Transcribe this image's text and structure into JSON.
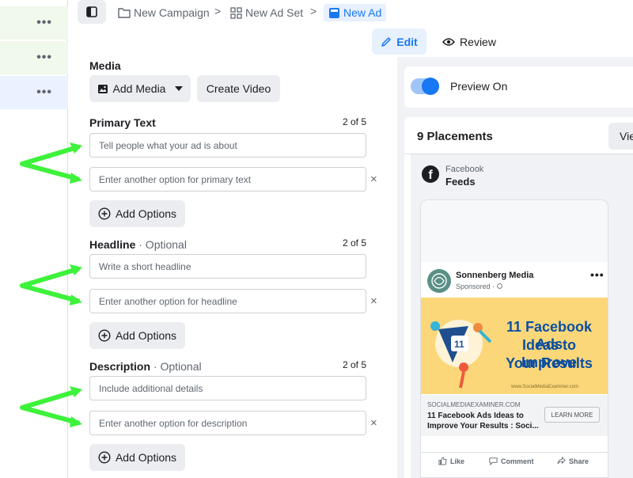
{
  "sidebar": {
    "rows": [
      "•••",
      "•••",
      "•••"
    ]
  },
  "breadcrumb": {
    "campaign": "New Campaign",
    "adset": "New Ad Set",
    "ad": "New Ad",
    "sep": ">"
  },
  "mode": {
    "edit": "Edit",
    "review": "Review"
  },
  "media": {
    "title": "Media",
    "add_media": "Add Media",
    "create_video": "Create Video"
  },
  "primary_text": {
    "title": "Primary Text",
    "count": "2 of 5",
    "field1_placeholder": "Tell people what your ad is about",
    "field2_placeholder": "Enter another option for primary text",
    "add_options": "Add Options"
  },
  "headline": {
    "title": "Headline",
    "optional": "· Optional",
    "count": "2 of 5",
    "field1_placeholder": "Write a short headline",
    "field2_placeholder": "Enter another option for headline",
    "add_options": "Add Options"
  },
  "description": {
    "title": "Description",
    "optional": "· Optional",
    "count": "2 of 5",
    "field1_placeholder": "Include additional details",
    "field2_placeholder": "Enter another option for description",
    "add_options": "Add Options"
  },
  "close_glyph": "×",
  "preview": {
    "toggle_label": "Preview On",
    "toggle_on": true,
    "placements_title": "9 Placements",
    "view_btn": "Vie",
    "platform": "Facebook",
    "placement": "Feeds",
    "post": {
      "page_name": "Sonnenberg Media",
      "sponsored": "Sponsored · ",
      "creative_lines": [
        "11 Facebook Ads",
        "Ideas to Improve",
        "Your Results"
      ],
      "creative_url": "www.SocialMediaExaminer.com",
      "link_domain": "SOCIALMEDIAEXAMINER.COM",
      "link_headline": "11 Facebook Ads Ideas to Improve Your Results : Soci...",
      "cta": "LEARN MORE",
      "actions": {
        "like": "Like",
        "comment": "Comment",
        "share": "Share"
      }
    }
  },
  "colors": {
    "accent": "#1877f2",
    "arrow": "#3df23a",
    "creative_bg": "#fbd77a",
    "creative_text": "#0d4fa0"
  }
}
